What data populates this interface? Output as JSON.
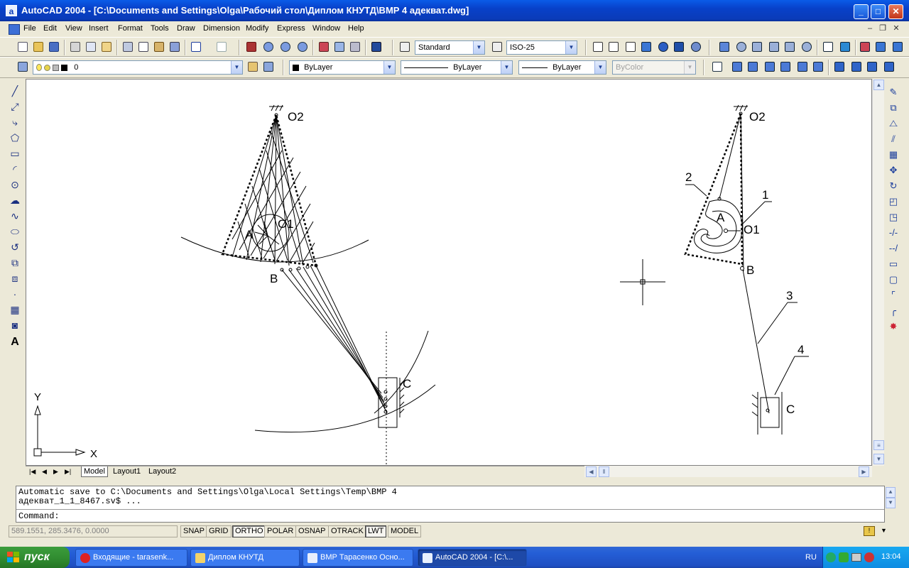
{
  "window": {
    "title": "AutoCAD 2004 - [C:\\Documents and Settings\\Olga\\Рабочий стол\\Диплом КНУТД\\ВМР 4 адекват.dwg]",
    "app_icon": "a",
    "buttons": {
      "minimize": "_",
      "maximize": "□",
      "close": "✕"
    }
  },
  "menu": {
    "items": [
      "File",
      "Edit",
      "View",
      "Insert",
      "Format",
      "Tools",
      "Draw",
      "Dimension",
      "Modify",
      "Express",
      "Window",
      "Help"
    ],
    "mdi": {
      "minimize": "–",
      "restore": "❐",
      "close": "✕"
    }
  },
  "toolbar": {
    "text_style": "Standard",
    "dim_style": "ISO-25",
    "layer": "0",
    "color": "ByLayer",
    "linetype": "ByLayer",
    "lineweight": "ByLayer",
    "plot_style": "ByColor"
  },
  "drawing": {
    "labels": {
      "o2_left": "O2",
      "o1_left": "O1",
      "a_left": "A",
      "b_left": "B",
      "c_left": "C",
      "o2_right": "O2",
      "o1_right": "O1",
      "a_right": "A",
      "b_right": "B",
      "c_right": "C",
      "n1": "1",
      "n2": "2",
      "n3": "3",
      "n4": "4",
      "ucs_y": "Y",
      "ucs_x": "X"
    }
  },
  "layout_tabs": [
    "Model",
    "Layout1",
    "Layout2"
  ],
  "command": {
    "history": [
      "Automatic save to C:\\Documents and Settings\\Olga\\Local Settings\\Temp\\ВМР 4",
      "адекват_1_1_8467.sv$ ..."
    ],
    "prompt": "Command:"
  },
  "status": {
    "coords": "589.1551, 285.3476, 0.0000",
    "toggles": [
      {
        "label": "SNAP",
        "on": false
      },
      {
        "label": "GRID",
        "on": false
      },
      {
        "label": "ORTHO",
        "on": true
      },
      {
        "label": "POLAR",
        "on": false
      },
      {
        "label": "OSNAP",
        "on": false
      },
      {
        "label": "OTRACK",
        "on": false
      },
      {
        "label": "LWT",
        "on": true
      },
      {
        "label": "MODEL",
        "on": false
      }
    ]
  },
  "taskbar": {
    "start": "пуск",
    "tasks": [
      "Входящие - tarasenk...",
      "Диплом КНУТД",
      "ВМР Тарасенко Осно...",
      "AutoCAD 2004 - [C:\\..."
    ],
    "lang": "RU",
    "clock": "13:04"
  }
}
